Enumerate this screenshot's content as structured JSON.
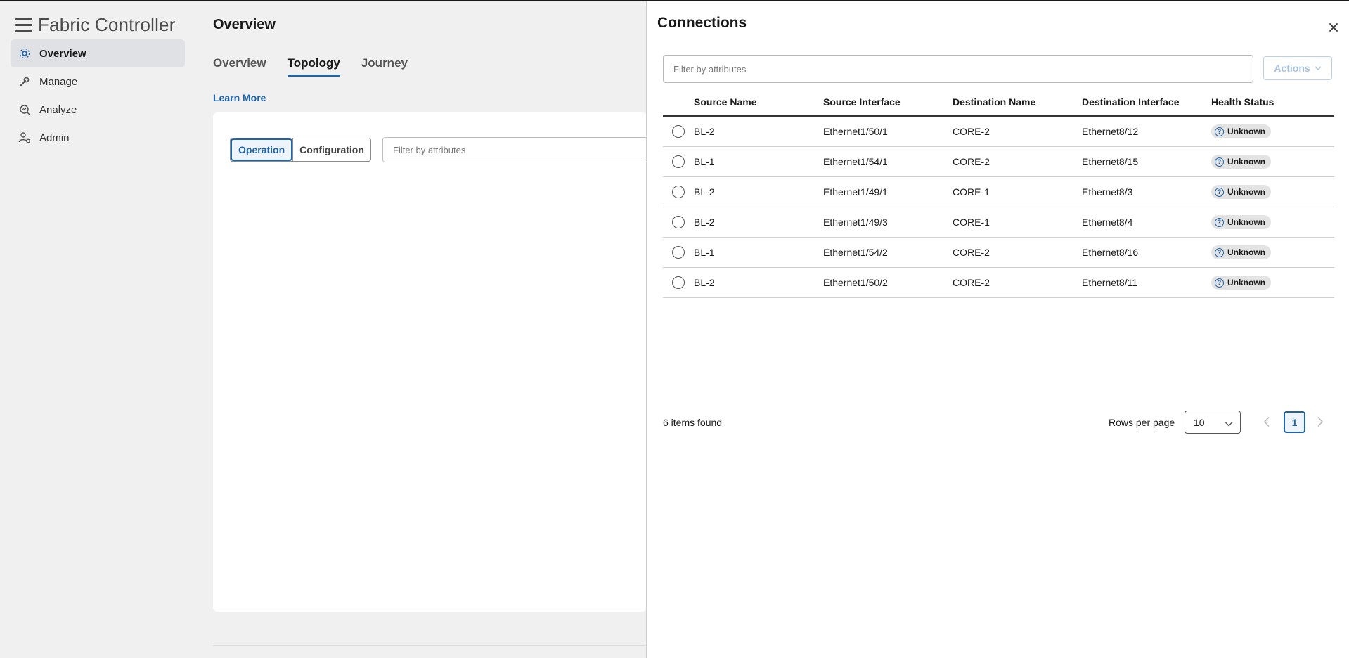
{
  "app": {
    "title": "Fabric Controller"
  },
  "sidebar": {
    "items": [
      {
        "label": "Overview",
        "icon": "overview-icon",
        "active": true
      },
      {
        "label": "Manage",
        "icon": "wrench-icon"
      },
      {
        "label": "Analyze",
        "icon": "analyze-icon"
      },
      {
        "label": "Admin",
        "icon": "admin-icon"
      }
    ]
  },
  "main": {
    "title": "Overview",
    "tabs": [
      {
        "label": "Overview"
      },
      {
        "label": "Topology",
        "active": true
      },
      {
        "label": "Journey"
      }
    ],
    "learn_more": "Learn More",
    "segments": [
      "Operation",
      "Configuration"
    ],
    "filter_placeholder": "Filter by attributes"
  },
  "panel": {
    "title": "Connections",
    "filter_placeholder": "Filter by attributes",
    "actions_label": "Actions",
    "columns": [
      "Source Name",
      "Source Interface",
      "Destination Name",
      "Destination Interface",
      "Health Status"
    ],
    "rows": [
      [
        "BL-2",
        "Ethernet1/50/1",
        "CORE-2",
        "Ethernet8/12",
        "Unknown"
      ],
      [
        "BL-1",
        "Ethernet1/54/1",
        "CORE-2",
        "Ethernet8/15",
        "Unknown"
      ],
      [
        "BL-2",
        "Ethernet1/49/1",
        "CORE-1",
        "Ethernet8/3",
        "Unknown"
      ],
      [
        "BL-2",
        "Ethernet1/49/3",
        "CORE-1",
        "Ethernet8/4",
        "Unknown"
      ],
      [
        "BL-1",
        "Ethernet1/54/2",
        "CORE-2",
        "Ethernet8/16",
        "Unknown"
      ],
      [
        "BL-2",
        "Ethernet1/50/2",
        "CORE-2",
        "Ethernet8/11",
        "Unknown"
      ]
    ],
    "items_found": "6 items found",
    "rows_per_page_label": "Rows per page",
    "rows_per_page": "10",
    "current_page": "1"
  },
  "colors": {
    "accent": "#1f63a8",
    "background": "#f0f0f0",
    "badge": "#e3e3e3"
  }
}
